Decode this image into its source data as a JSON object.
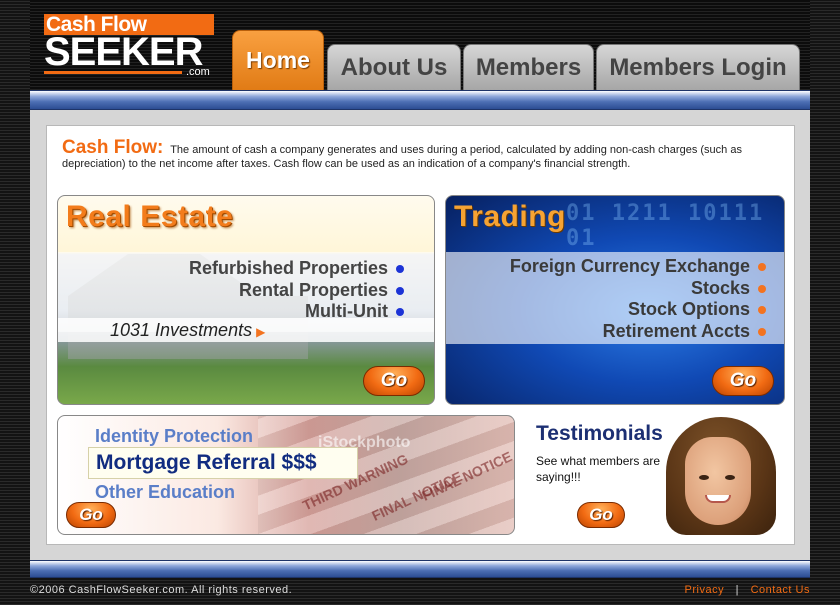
{
  "logo": {
    "top": "Cash Flow",
    "main": "SEEKER",
    "suffix": ".com"
  },
  "nav": {
    "tabs": [
      "Home",
      "About Us",
      "Members",
      "Members Login"
    ],
    "active": "Home"
  },
  "intro": {
    "title": "Cash Flow:",
    "text": "The amount of cash a company generates and uses during a period, calculated by adding non-cash charges (such as depreciation) to the net income after taxes. Cash flow can be used as an indication of a company's financial strength."
  },
  "real_estate": {
    "title": "Real Estate",
    "items": [
      "Refurbished Properties",
      "Rental Properties",
      "Multi-Unit"
    ],
    "featured": "1031 Investments",
    "go": "Go"
  },
  "trading": {
    "title": "Trading",
    "items": [
      "Foreign Currency Exchange",
      "Stocks",
      "Stock Options",
      "Retirement Accts"
    ],
    "go": "Go"
  },
  "other": {
    "items": [
      "Identity Protection",
      "Mortgage Referral $$$",
      "Other Education"
    ],
    "stamp_text": [
      "FINAL NOTICE",
      "FINAL NOTICE",
      "THIRD WARNING"
    ],
    "watermark": "iStockphoto",
    "go": "Go"
  },
  "testimonials": {
    "title": "Testimonials",
    "text": "See what members are saying!!!",
    "go": "Go"
  },
  "footer": {
    "copyright": "©2006 CashFlowSeeker.com. All rights reserved.",
    "links": [
      "Privacy",
      "Contact Us"
    ],
    "separator": "|"
  },
  "colors": {
    "accent": "#f26b13",
    "nav_blue": "#4d6fb4",
    "heading_blue": "#1c2f73"
  }
}
